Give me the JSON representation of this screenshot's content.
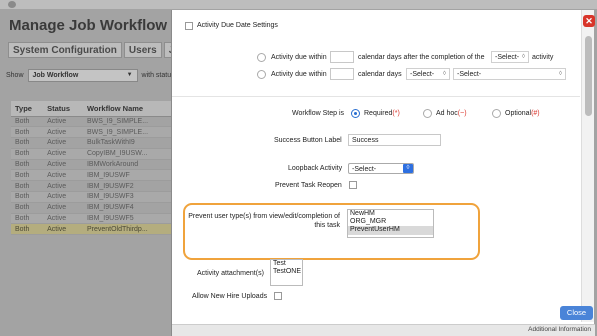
{
  "app": {
    "title": "Manage Job Workflow",
    "tabs": [
      "System Configuration",
      "Users",
      "Job"
    ],
    "show_label": "Show",
    "show_select": "Job Workflow",
    "with_status_label": "with status",
    "table": {
      "headers": [
        "Type",
        "Status",
        "Workflow Name"
      ],
      "rows": [
        [
          "Both",
          "Active",
          "BWS_I9_SIMPLE..."
        ],
        [
          "Both",
          "Active",
          "BWS_I9_SIMPLE..."
        ],
        [
          "Both",
          "Active",
          "BulkTaskWithI9"
        ],
        [
          "Both",
          "Active",
          "CopyIBM_I9USW..."
        ],
        [
          "Both",
          "Active",
          "IBMWorkAround"
        ],
        [
          "Both",
          "Active",
          "IBM_I9USWF"
        ],
        [
          "Both",
          "Active",
          "IBM_I9USWF2"
        ],
        [
          "Both",
          "Active",
          "IBM_I9USWF3"
        ],
        [
          "Both",
          "Active",
          "IBM_I9USWF4"
        ],
        [
          "Both",
          "Active",
          "IBM_I9USWF5"
        ],
        [
          "Both",
          "Active",
          "PreventOldThirdp..."
        ]
      ]
    }
  },
  "modal": {
    "close_icon_glyph": "✕",
    "activity_due_date_settings": "Activity Due Date Settings",
    "due_within_1": {
      "label": "Activity due within",
      "text": "calendar days after the completion of the",
      "select": "-Select-",
      "suffix": "activity"
    },
    "due_within_2": {
      "label": "Activity due within",
      "text": "calendar days",
      "select1": "-Select-",
      "select2": "-Select-"
    },
    "workflow_step": {
      "label": "Workflow Step is",
      "options": [
        {
          "label": "Required",
          "mark": "(*)",
          "selected": true
        },
        {
          "label": "Ad hoc",
          "mark": "(~)",
          "selected": false
        },
        {
          "label": "Optional",
          "mark": "(#)",
          "selected": false
        }
      ]
    },
    "success_button": {
      "label": "Success Button Label",
      "value": "Success"
    },
    "loopback": {
      "label": "Loopback Activity",
      "value": "-Select-"
    },
    "prevent_reopen": {
      "label": "Prevent Task Reopen"
    },
    "prevent_user_types": {
      "label_line1": "Prevent user type(s) from view/edit/completion of",
      "label_line2": "this task",
      "options": [
        "NewHM",
        "ORG_MGR",
        "PreventUserHM"
      ],
      "selected_index": 2
    },
    "attachments": {
      "label": "Activity attachment(s)",
      "options": [
        "Test",
        "TestONE"
      ]
    },
    "new_hire_uploads": {
      "label": "Allow New Hire Uploads"
    },
    "close_button": "Close",
    "bottom_text": "Additional Information"
  },
  "colors": {
    "accent_blue": "#2d6fe0",
    "highlight_orange": "#f0a33c",
    "required_red": "#d9342b",
    "close_red": "#d8352a"
  }
}
